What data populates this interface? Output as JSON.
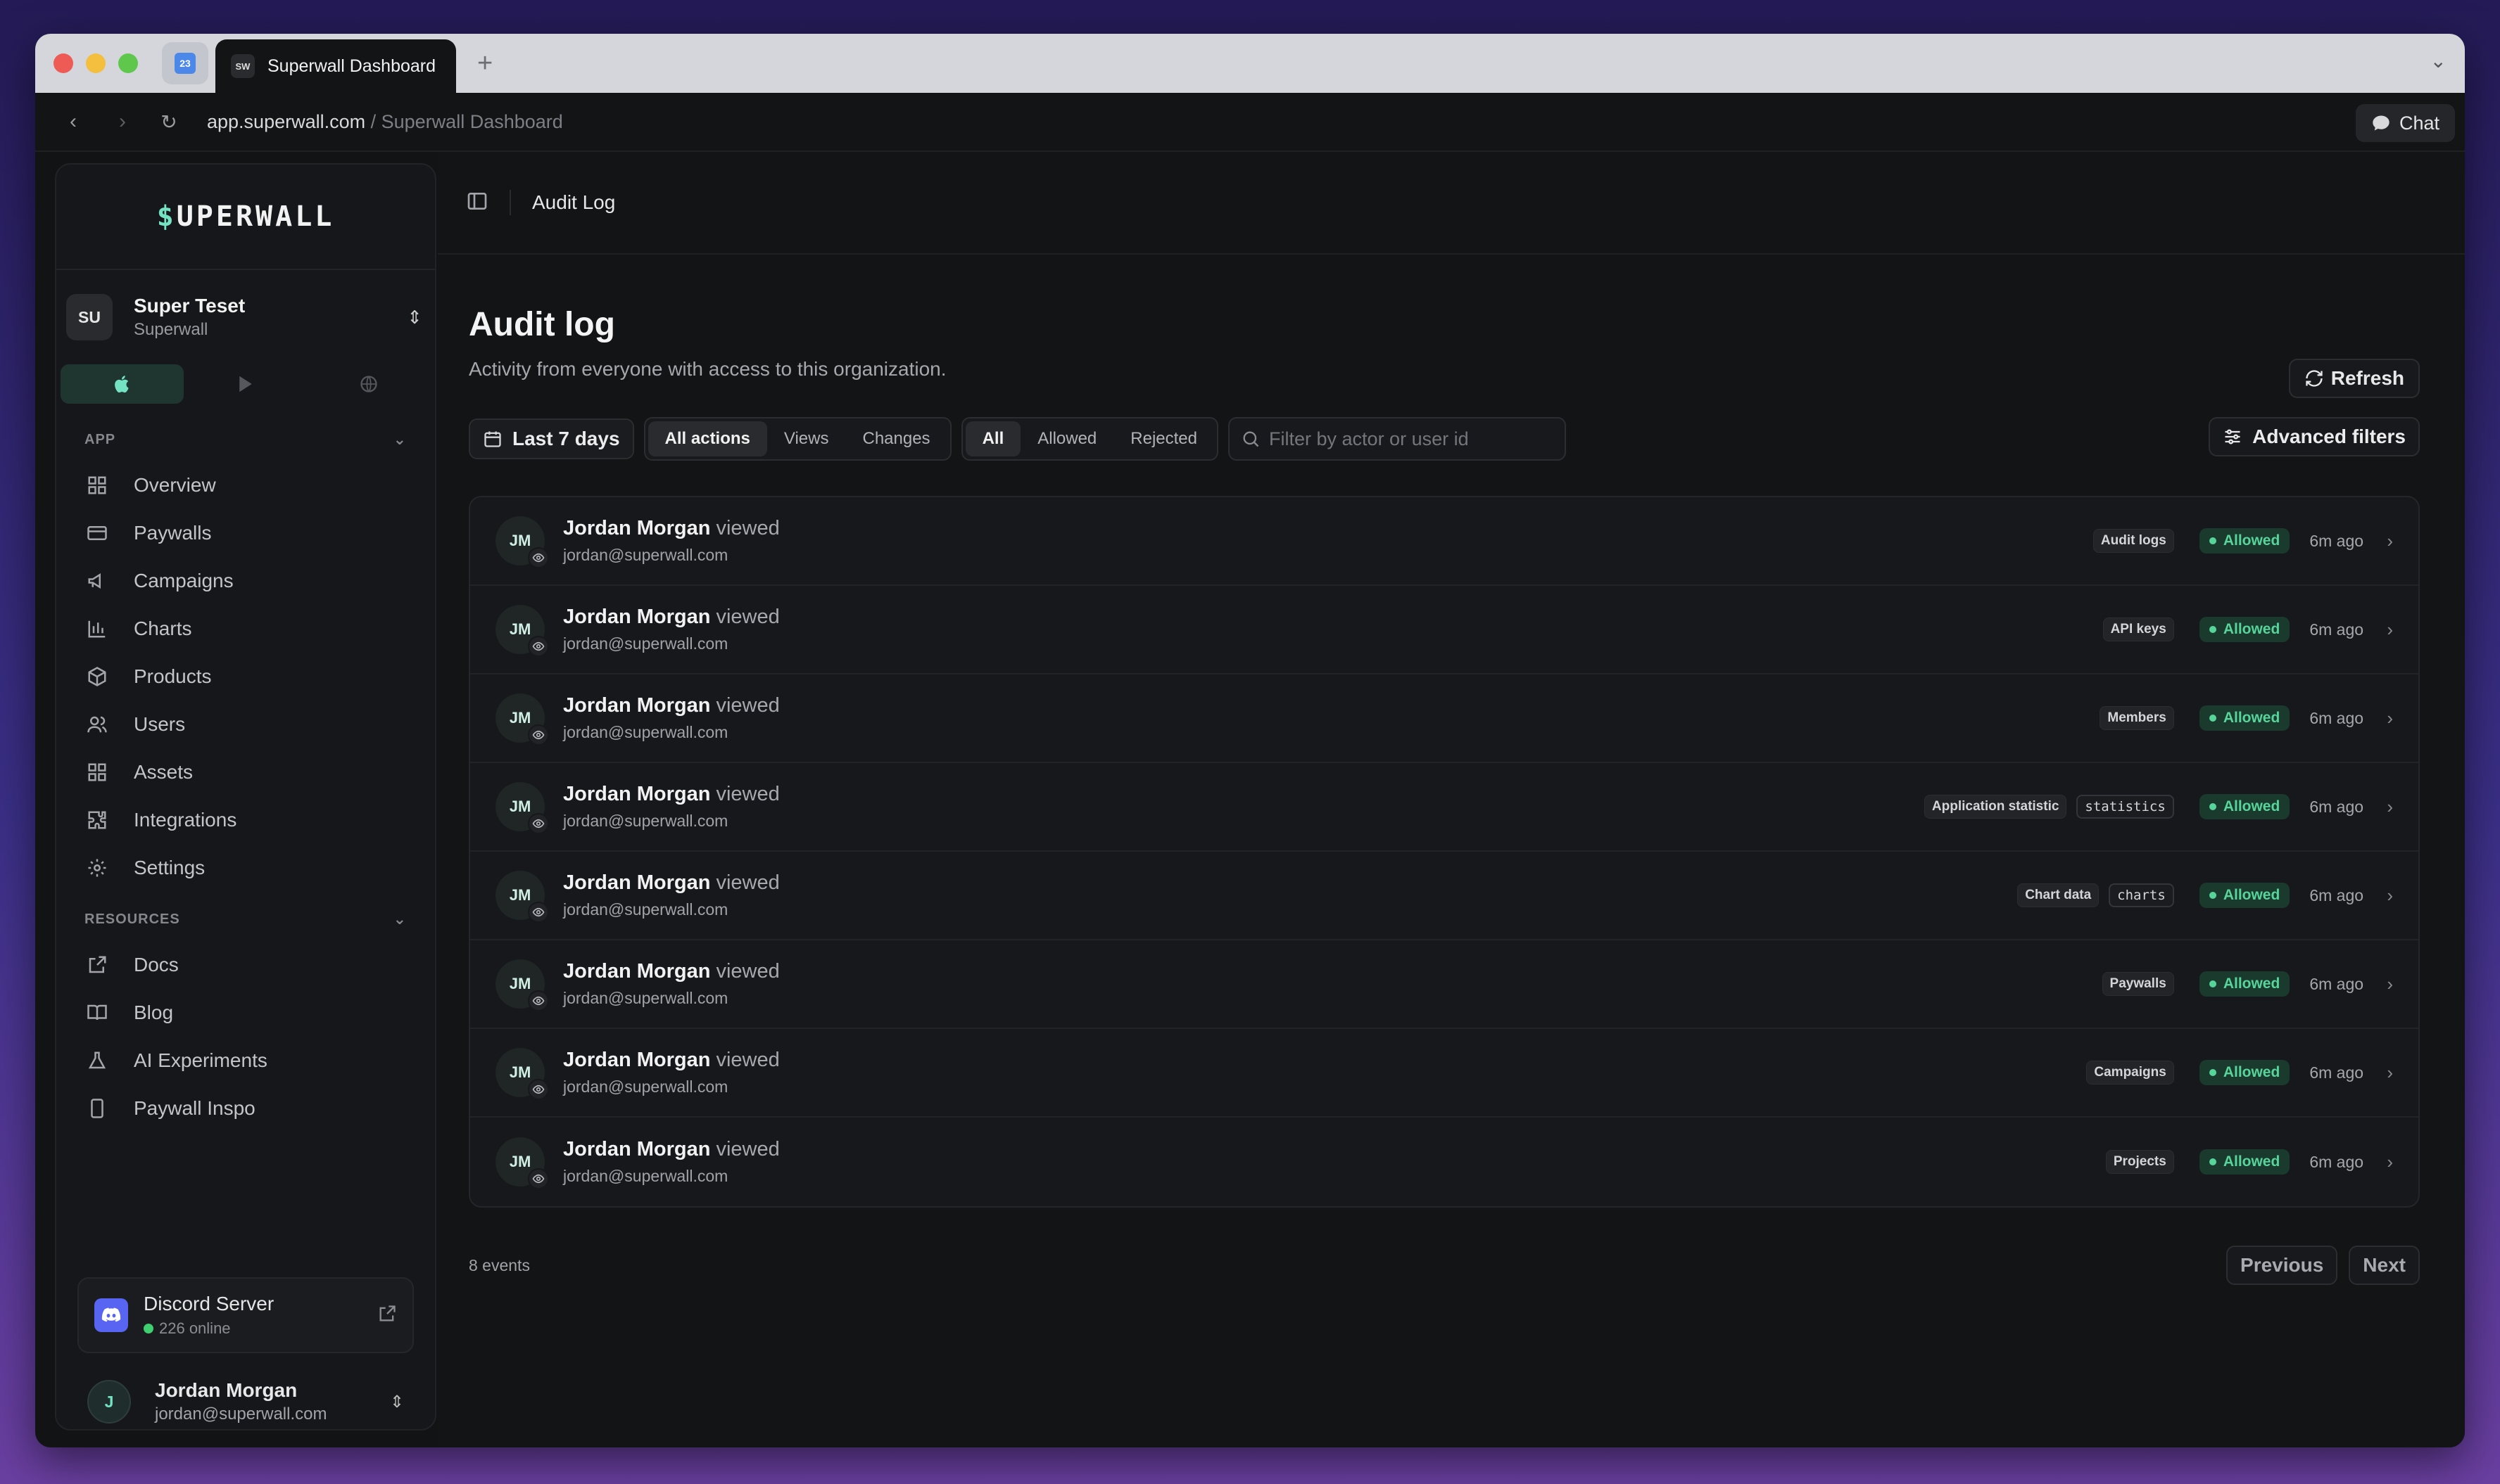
{
  "browser": {
    "tab_title": "Superwall Dashboard",
    "tab_favicon": "SW",
    "pinned_tab_icon": "23",
    "url_host": "app.superwall.com",
    "url_rest": " / Superwall Dashboard",
    "chat_label": "Chat"
  },
  "sidebar": {
    "logo": "SUPERWALL",
    "org": {
      "avatar": "SU",
      "name": "Super Teset",
      "sub": "Superwall"
    },
    "section_app": "APP",
    "app_items": [
      {
        "label": "Overview"
      },
      {
        "label": "Paywalls"
      },
      {
        "label": "Campaigns"
      },
      {
        "label": "Charts"
      },
      {
        "label": "Products"
      },
      {
        "label": "Users"
      },
      {
        "label": "Assets"
      },
      {
        "label": "Integrations"
      },
      {
        "label": "Settings"
      }
    ],
    "section_resources": "RESOURCES",
    "resource_items": [
      {
        "label": "Docs"
      },
      {
        "label": "Blog"
      },
      {
        "label": "AI Experiments"
      },
      {
        "label": "Paywall Inspo"
      }
    ],
    "discord": {
      "title": "Discord Server",
      "online": "226 online"
    },
    "user": {
      "initial": "J",
      "name": "Jordan Morgan",
      "email": "jordan@superwall.com"
    }
  },
  "topbar": {
    "breadcrumb": "Audit Log"
  },
  "page": {
    "title": "Audit log",
    "subtitle": "Activity from everyone with access to this organization.",
    "refresh_label": "Refresh",
    "date_range": "Last 7 days",
    "action_filters": [
      "All actions",
      "Views",
      "Changes"
    ],
    "result_filters": [
      "All",
      "Allowed",
      "Rejected"
    ],
    "search_placeholder": "Filter by actor or user id",
    "advanced_label": "Advanced filters",
    "events_count": "8 events",
    "prev_label": "Previous",
    "next_label": "Next"
  },
  "log_rows": [
    {
      "initials": "JM",
      "name": "Jordan Morgan",
      "verb": "viewed",
      "email": "jordan@superwall.com",
      "tags": [
        "Audit logs"
      ],
      "mono_tag": "",
      "status": "Allowed",
      "time": "6m ago"
    },
    {
      "initials": "JM",
      "name": "Jordan Morgan",
      "verb": "viewed",
      "email": "jordan@superwall.com",
      "tags": [
        "API keys"
      ],
      "mono_tag": "",
      "status": "Allowed",
      "time": "6m ago"
    },
    {
      "initials": "JM",
      "name": "Jordan Morgan",
      "verb": "viewed",
      "email": "jordan@superwall.com",
      "tags": [
        "Members"
      ],
      "mono_tag": "",
      "status": "Allowed",
      "time": "6m ago"
    },
    {
      "initials": "JM",
      "name": "Jordan Morgan",
      "verb": "viewed",
      "email": "jordan@superwall.com",
      "tags": [
        "Application statistic"
      ],
      "mono_tag": "statistics",
      "status": "Allowed",
      "time": "6m ago"
    },
    {
      "initials": "JM",
      "name": "Jordan Morgan",
      "verb": "viewed",
      "email": "jordan@superwall.com",
      "tags": [
        "Chart data"
      ],
      "mono_tag": "charts",
      "status": "Allowed",
      "time": "6m ago"
    },
    {
      "initials": "JM",
      "name": "Jordan Morgan",
      "verb": "viewed",
      "email": "jordan@superwall.com",
      "tags": [
        "Paywalls"
      ],
      "mono_tag": "",
      "status": "Allowed",
      "time": "6m ago"
    },
    {
      "initials": "JM",
      "name": "Jordan Morgan",
      "verb": "viewed",
      "email": "jordan@superwall.com",
      "tags": [
        "Campaigns"
      ],
      "mono_tag": "",
      "status": "Allowed",
      "time": "6m ago"
    },
    {
      "initials": "JM",
      "name": "Jordan Morgan",
      "verb": "viewed",
      "email": "jordan@superwall.com",
      "tags": [
        "Projects"
      ],
      "mono_tag": "",
      "status": "Allowed",
      "time": "6m ago"
    }
  ],
  "colors": {
    "accent": "#74e3c4",
    "allowed": "#57d49a",
    "background": "#131416"
  }
}
